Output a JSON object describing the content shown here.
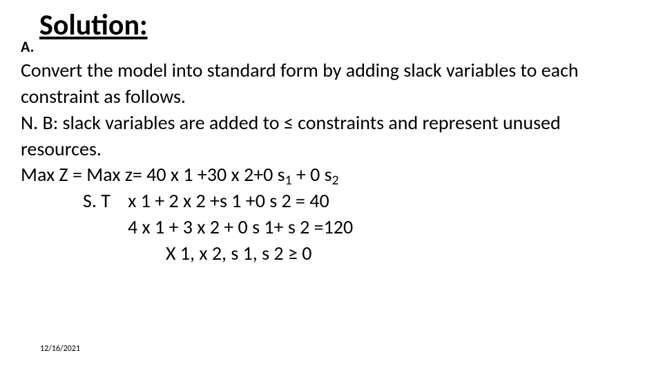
{
  "title": "Solution:",
  "part_label": "A.",
  "body": {
    "line1": "Convert the model into standard form by adding slack variables to each constraint as follows.",
    "line2": "N. B: slack variables are added to ≤ constraints and represent unused resources.",
    "maxz_prefix": "Max Z = Max z= 40 x 1 +30 x 2+0 s",
    "maxz_sub1": "1",
    "maxz_mid": " + 0 s",
    "maxz_sub2": "2",
    "st_label": "S. T",
    "st_line1": "x 1 + 2 x 2 +s 1 +0 s 2 = 40",
    "st_line2": "4 x 1 + 3 x 2 + 0 s 1+ s 2 =120",
    "nonneg": "X 1, x 2, s 1, s 2 ≥ 0"
  },
  "footer_date": "12/16/2021"
}
